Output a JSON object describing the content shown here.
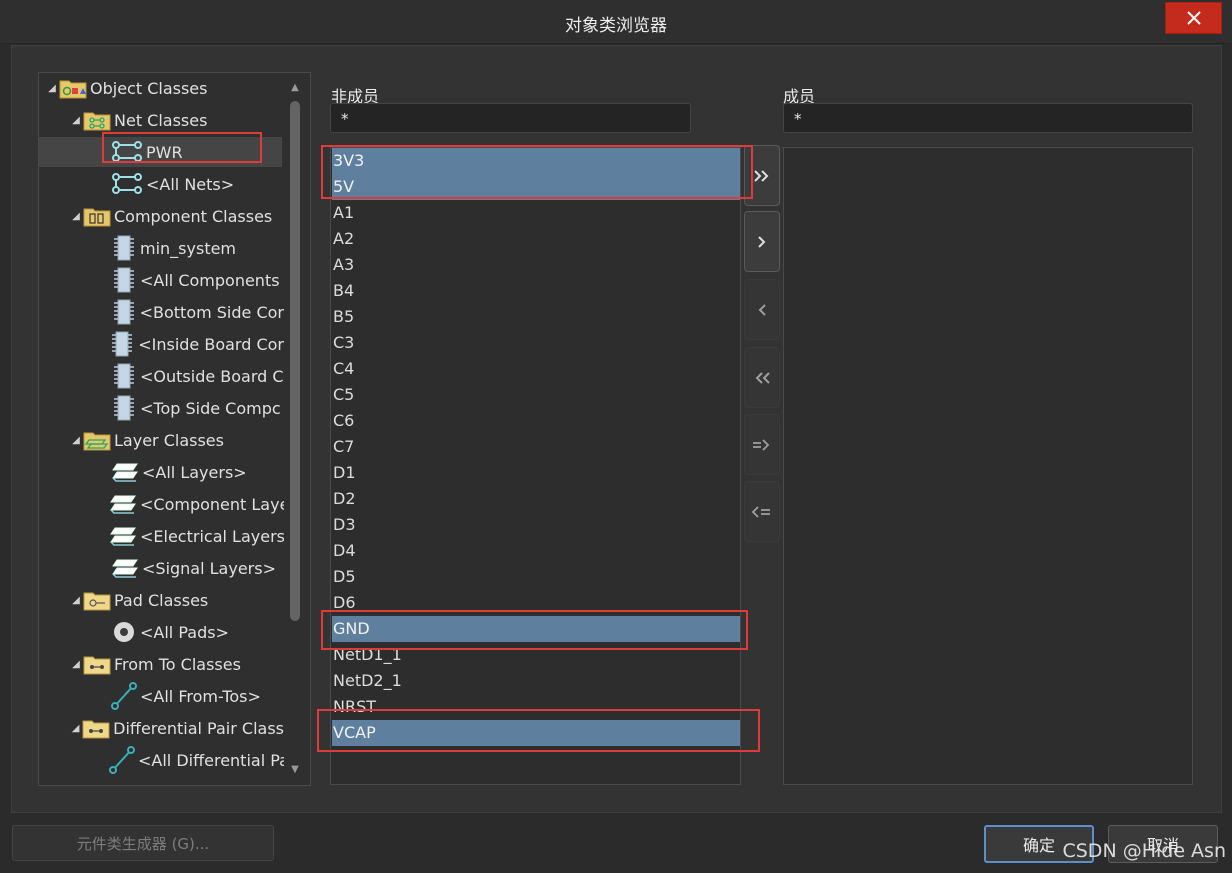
{
  "window": {
    "title": "对象类浏览器",
    "close_icon": "×"
  },
  "tree": {
    "items": [
      {
        "label": "Object Classes",
        "level": 0,
        "arrow": "◢",
        "icon": "folder-shapes-icon"
      },
      {
        "label": "Net Classes",
        "level": 1,
        "arrow": "◢",
        "icon": "folder-net-icon"
      },
      {
        "label": "PWR",
        "level": 2,
        "arrow": "",
        "icon": "net-icon",
        "selected": true
      },
      {
        "label": "<All Nets>",
        "level": 2,
        "arrow": "",
        "icon": "net-icon"
      },
      {
        "label": "Component Classes",
        "level": 1,
        "arrow": "◢",
        "icon": "folder-component-icon"
      },
      {
        "label": "min_system",
        "level": 2,
        "arrow": "",
        "icon": "component-icon"
      },
      {
        "label": "<All Components",
        "level": 2,
        "arrow": "",
        "icon": "component-icon"
      },
      {
        "label": "<Bottom Side Cor",
        "level": 2,
        "arrow": "",
        "icon": "component-icon"
      },
      {
        "label": "<Inside Board Cor",
        "level": 2,
        "arrow": "",
        "icon": "component-icon"
      },
      {
        "label": "<Outside Board C",
        "level": 2,
        "arrow": "",
        "icon": "component-icon"
      },
      {
        "label": "<Top Side Compc",
        "level": 2,
        "arrow": "",
        "icon": "component-icon"
      },
      {
        "label": "Layer Classes",
        "level": 1,
        "arrow": "◢",
        "icon": "folder-layer-icon"
      },
      {
        "label": "<All Layers>",
        "level": 2,
        "arrow": "",
        "icon": "layer-icon"
      },
      {
        "label": "<Component Laye",
        "level": 2,
        "arrow": "",
        "icon": "layer-icon"
      },
      {
        "label": "<Electrical Layers>",
        "level": 2,
        "arrow": "",
        "icon": "layer-icon"
      },
      {
        "label": "<Signal Layers>",
        "level": 2,
        "arrow": "",
        "icon": "layer-icon"
      },
      {
        "label": "Pad Classes",
        "level": 1,
        "arrow": "◢",
        "icon": "folder-pad-icon"
      },
      {
        "label": "<All Pads>",
        "level": 2,
        "arrow": "",
        "icon": "pad-icon"
      },
      {
        "label": "From To Classes",
        "level": 1,
        "arrow": "◢",
        "icon": "folder-fromto-icon"
      },
      {
        "label": "<All From-Tos>",
        "level": 2,
        "arrow": "",
        "icon": "fromto-icon"
      },
      {
        "label": "Differential Pair Class",
        "level": 1,
        "arrow": "◢",
        "icon": "folder-diffpair-icon"
      },
      {
        "label": "<All Differential Pa",
        "level": 2,
        "arrow": "",
        "icon": "fromto-icon"
      }
    ]
  },
  "non_members": {
    "label": "非成员",
    "filter": "*",
    "items": [
      {
        "text": "3V3",
        "selected": true
      },
      {
        "text": "5V",
        "selected": true
      },
      {
        "text": "A1"
      },
      {
        "text": "A2"
      },
      {
        "text": "A3"
      },
      {
        "text": "B4"
      },
      {
        "text": "B5"
      },
      {
        "text": "C3"
      },
      {
        "text": "C4"
      },
      {
        "text": "C5"
      },
      {
        "text": "C6"
      },
      {
        "text": "C7"
      },
      {
        "text": "D1"
      },
      {
        "text": "D2"
      },
      {
        "text": "D3"
      },
      {
        "text": "D4"
      },
      {
        "text": "D5"
      },
      {
        "text": "D6"
      },
      {
        "text": "GND",
        "selected": true
      },
      {
        "text": "NetD1_1"
      },
      {
        "text": "NetD2_1"
      },
      {
        "text": "NRST"
      },
      {
        "text": "VCAP",
        "selected": true
      }
    ]
  },
  "members": {
    "label": "成员",
    "filter": "*",
    "items": []
  },
  "transfer_buttons": [
    {
      "name": "add-all-button",
      "glyph": "»",
      "enabled": true
    },
    {
      "name": "add-button",
      "glyph": "›",
      "enabled": true
    },
    {
      "name": "remove-button",
      "glyph": "‹",
      "enabled": false
    },
    {
      "name": "remove-all-button",
      "glyph": "«",
      "enabled": false
    },
    {
      "name": "add-filtered-button",
      "glyph": "=>",
      "enabled": false
    },
    {
      "name": "remove-filtered-button",
      "glyph": "<=",
      "enabled": false
    }
  ],
  "footer": {
    "generator_label": "元件类生成器 (G)...",
    "ok_label": "确定",
    "cancel_label": "取消",
    "watermark": "CSDN @Hide Asn"
  }
}
